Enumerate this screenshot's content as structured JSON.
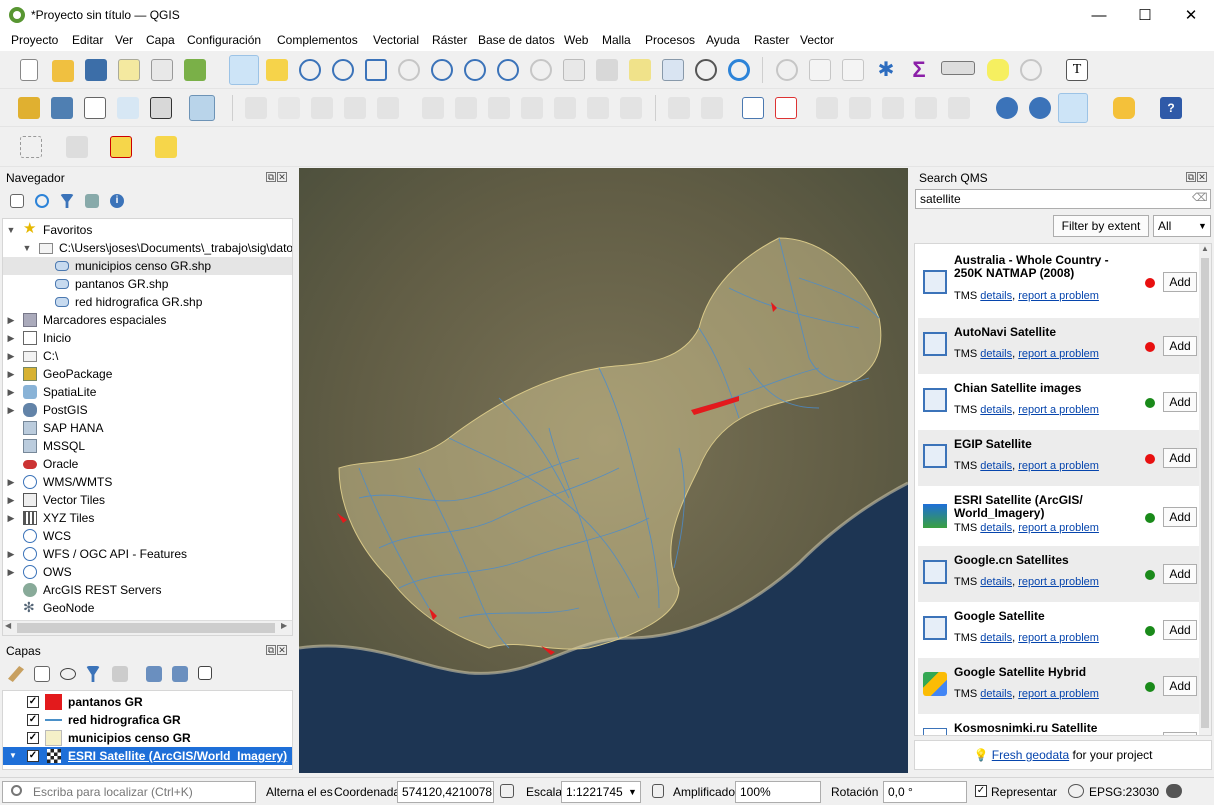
{
  "window": {
    "title": "*Proyecto sin título — QGIS",
    "minimize": "—",
    "maximize": "☐",
    "close": "✕"
  },
  "menu": [
    "Proyecto",
    "Editar",
    "Ver",
    "Capa",
    "Configuración",
    "Complementos",
    "Vectorial",
    "Ráster",
    "Base de datos",
    "Web",
    "Malla",
    "Procesos",
    "Ayuda",
    "Raster",
    "Vector"
  ],
  "navigator": {
    "title": "Navegador",
    "items": [
      {
        "label": "Favoritos",
        "icon": "star-icon"
      },
      {
        "label": "C:\\Users\\joses\\Documents\\_trabajo\\sig\\datos",
        "icon": "folder-icon"
      },
      {
        "label": "municipios censo GR.shp",
        "icon": "polygon-layer-icon"
      },
      {
        "label": "pantanos GR.shp",
        "icon": "polygon-layer-icon"
      },
      {
        "label": "red hidrografica GR.shp",
        "icon": "polygon-layer-icon"
      },
      {
        "label": "Marcadores espaciales",
        "icon": "bookmark-icon"
      },
      {
        "label": "Inicio",
        "icon": "home-icon"
      },
      {
        "label": "C:\\",
        "icon": "drive-icon"
      },
      {
        "label": "GeoPackage",
        "icon": "geopackage-icon"
      },
      {
        "label": "SpatiaLite",
        "icon": "spatialite-icon"
      },
      {
        "label": "PostGIS",
        "icon": "postgis-icon"
      },
      {
        "label": "SAP HANA",
        "icon": "saphana-icon"
      },
      {
        "label": "MSSQL",
        "icon": "mssql-icon"
      },
      {
        "label": "Oracle",
        "icon": "oracle-icon"
      },
      {
        "label": "WMS/WMTS",
        "icon": "globe-icon"
      },
      {
        "label": "Vector Tiles",
        "icon": "vector-tiles-icon"
      },
      {
        "label": "XYZ Tiles",
        "icon": "xyz-tiles-icon"
      },
      {
        "label": "WCS",
        "icon": "wcs-icon"
      },
      {
        "label": "WFS / OGC API - Features",
        "icon": "wfs-icon"
      },
      {
        "label": "OWS",
        "icon": "ows-icon"
      },
      {
        "label": "ArcGIS REST Servers",
        "icon": "arcgis-icon"
      },
      {
        "label": "GeoNode",
        "icon": "geonode-icon"
      }
    ]
  },
  "layers": {
    "title": "Capas",
    "items": [
      {
        "label": "pantanos GR",
        "color": "#e31a1c"
      },
      {
        "label": "red hidrografica GR",
        "color": "#4a90c8"
      },
      {
        "label": "municipios censo GR",
        "color": "#f5f0c8"
      },
      {
        "label": "ESRI Satellite (ArcGIS/World_Imagery)",
        "color": "#1e6fd8"
      }
    ]
  },
  "qms": {
    "title": "Search QMS",
    "search_value": "satellite",
    "filter_button": "Filter by extent",
    "filter_select": "All",
    "details_link": "details",
    "report_link": "report a problem",
    "add_label": "Add",
    "items": [
      {
        "name": "Australia - Whole Country - 250K NATMAP (2008)",
        "type": "TMS",
        "status": "red",
        "icon": "map-icon"
      },
      {
        "name": "AutoNavi Satellite",
        "type": "TMS",
        "status": "red",
        "icon": "map-icon"
      },
      {
        "name": "Chian Satellite images",
        "type": "TMS",
        "status": "green",
        "icon": "map-icon"
      },
      {
        "name": "EGIP Satellite",
        "type": "TMS",
        "status": "red",
        "icon": "map-icon"
      },
      {
        "name": "ESRI Satellite (ArcGIS/ World_Imagery)",
        "type": "TMS",
        "status": "green",
        "icon": "arcgis-icon"
      },
      {
        "name": "Google.cn Satellites",
        "type": "TMS",
        "status": "green",
        "icon": "map-icon"
      },
      {
        "name": "Google Satellite",
        "type": "TMS",
        "status": "green",
        "icon": "map-icon"
      },
      {
        "name": "Google Satellite Hybrid",
        "type": "TMS",
        "status": "green",
        "icon": "google-maps-icon"
      },
      {
        "name": "Kosmosnimki.ru Satellite",
        "type": "",
        "status": "",
        "icon": "kosmosnimki-icon"
      }
    ],
    "footer_link": "Fresh geodata",
    "footer_text": "for your project"
  },
  "status": {
    "locate_placeholder": "Escriba para localizar (Ctrl+K)",
    "toggle_label": "Alterna el es",
    "coord_label": "Coordenada",
    "coord_value": "574120,4210078",
    "scale_label": "Escala",
    "scale_value": "1:1221745",
    "magnifier_label": "Amplificador",
    "magnifier_value": "100%",
    "rotation_label": "Rotación",
    "rotation_value": "0,0 °",
    "render_label": "Representar",
    "crs_label": "EPSG:23030"
  },
  "colors": {
    "status_red": "#e81010",
    "status_green": "#1a8a1a",
    "selection": "#0078d7",
    "link": "#0645ad"
  }
}
